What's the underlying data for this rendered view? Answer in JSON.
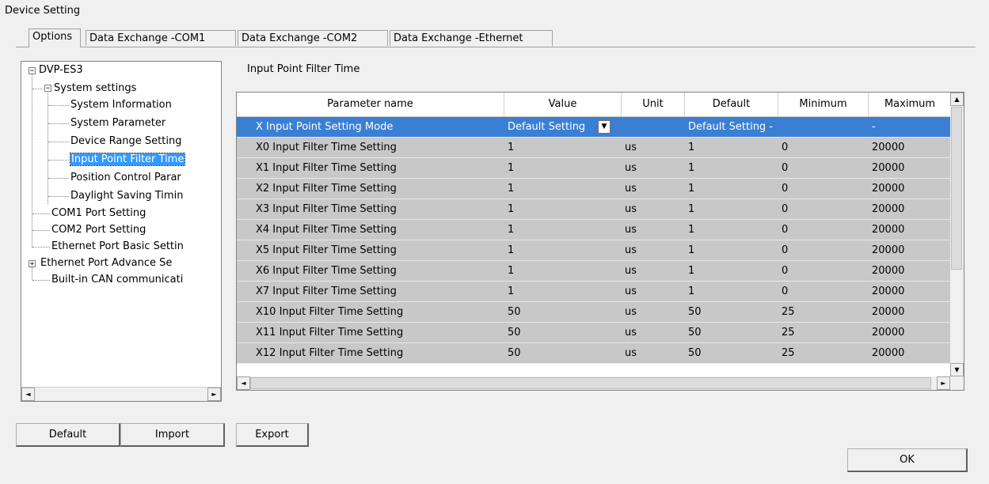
{
  "window": {
    "title": "Device Setting"
  },
  "tabs": [
    {
      "label": "Options"
    },
    {
      "label": "Data Exchange -COM1"
    },
    {
      "label": "Data Exchange -COM2"
    },
    {
      "label": "Data Exchange -Ethernet"
    }
  ],
  "tree": {
    "root": "DVP-ES3",
    "root_expander": "−",
    "system_settings": "System settings",
    "system_expander": "−",
    "ethernet_expander": "+",
    "items": [
      "System Information",
      "System Parameter",
      "Device Range Setting",
      "Input Point Filter Time",
      "Position Control Parar",
      "Daylight Saving Timin"
    ],
    "top_items": [
      "COM1 Port Setting",
      "COM2 Port Setting",
      "Ethernet Port Basic Settin",
      "Ethernet Port Advance Se",
      "Built-in CAN communicati"
    ]
  },
  "section_title": "Input Point Filter Time",
  "grid": {
    "headers": [
      "Parameter name",
      "Value",
      "Unit",
      "Default",
      "Minimum",
      "Maximum"
    ],
    "rows": [
      [
        "X Input Point Setting Mode",
        "Default Setting",
        "",
        "Default Setting -",
        "",
        "-"
      ],
      [
        "X0 Input Filter Time Setting",
        "1",
        "us",
        "1",
        "0",
        "20000"
      ],
      [
        "X1 Input Filter Time Setting",
        "1",
        "us",
        "1",
        "0",
        "20000"
      ],
      [
        "X2 Input Filter Time Setting",
        "1",
        "us",
        "1",
        "0",
        "20000"
      ],
      [
        "X3 Input Filter Time Setting",
        "1",
        "us",
        "1",
        "0",
        "20000"
      ],
      [
        "X4 Input Filter Time Setting",
        "1",
        "us",
        "1",
        "0",
        "20000"
      ],
      [
        "X5 Input Filter Time Setting",
        "1",
        "us",
        "1",
        "0",
        "20000"
      ],
      [
        "X6 Input Filter Time Setting",
        "1",
        "us",
        "1",
        "0",
        "20000"
      ],
      [
        "X7 Input Filter Time Setting",
        "1",
        "us",
        "1",
        "0",
        "20000"
      ],
      [
        "X10 Input Filter Time Setting",
        "50",
        "us",
        "50",
        "25",
        "20000"
      ],
      [
        "X11 Input Filter Time Setting",
        "50",
        "us",
        "50",
        "25",
        "20000"
      ],
      [
        "X12 Input Filter Time Setting",
        "50",
        "us",
        "50",
        "25",
        "20000"
      ]
    ]
  },
  "buttons": {
    "default": "Default",
    "import": "Import",
    "export": "Export",
    "ok": "OK"
  },
  "icons": {
    "scroll_up": "▲",
    "scroll_down": "▼",
    "scroll_left": "◄",
    "scroll_right": "►",
    "dropdown": "▼"
  },
  "colors": {
    "selection": "#3a7fd4",
    "tree_selection": "#3399ff",
    "grid_gray": "#c8c8c8"
  }
}
